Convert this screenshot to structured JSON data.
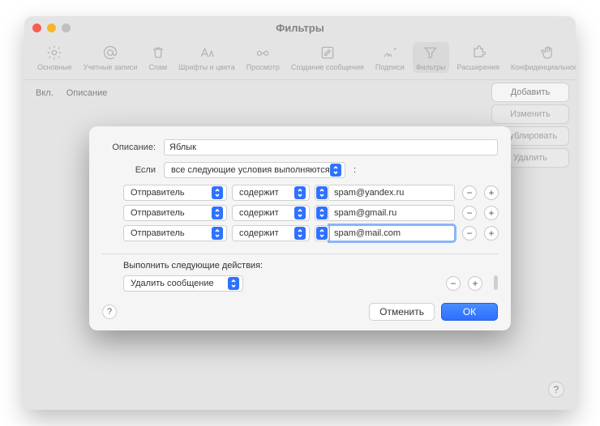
{
  "window": {
    "title": "Фильтры"
  },
  "toolbar": {
    "items": [
      {
        "name": "general",
        "label": "Основные"
      },
      {
        "name": "accounts",
        "label": "Учетные записи"
      },
      {
        "name": "junk",
        "label": "Спам"
      },
      {
        "name": "fonts",
        "label": "Шрифты и цвета"
      },
      {
        "name": "viewing",
        "label": "Просмотр"
      },
      {
        "name": "composing",
        "label": "Создание сообщения"
      },
      {
        "name": "signatures",
        "label": "Подписи"
      },
      {
        "name": "rules",
        "label": "Фильтры",
        "selected": true
      },
      {
        "name": "extensions",
        "label": "Расширения"
      },
      {
        "name": "privacy",
        "label": "Конфиденциальность"
      }
    ]
  },
  "list_header": {
    "enabled": "Вкл.",
    "description": "Описание"
  },
  "side_buttons": {
    "add": "Добавить",
    "edit": "Изменить",
    "duplicate": "Дублировать",
    "delete": "Удалить"
  },
  "sheet": {
    "description_label": "Описание:",
    "description_value": "Яблык",
    "if_label": "Если",
    "if_scope": "все следующие условия выполняются",
    "if_colon": ":",
    "conditions": [
      {
        "field": "Отправитель",
        "op": "содержит",
        "value": "spam@yandex.ru",
        "focused": false
      },
      {
        "field": "Отправитель",
        "op": "содержит",
        "value": "spam@gmail.ru",
        "focused": false
      },
      {
        "field": "Отправитель",
        "op": "содержит",
        "value": "spam@mail.com",
        "focused": true
      }
    ],
    "perform_label": "Выполнить следующие действия:",
    "actions": [
      {
        "type": "Удалить сообщение"
      }
    ],
    "cancel": "Отменить",
    "ok": "ОК",
    "help": "?"
  },
  "watermark": "Яблык",
  "corner_help": "?"
}
